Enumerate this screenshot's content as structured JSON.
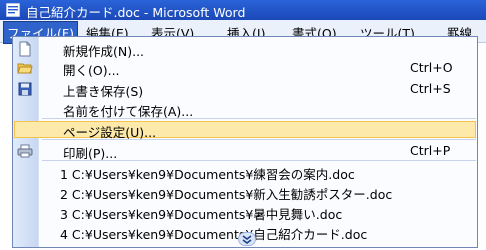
{
  "window": {
    "title": "自己紹介カード.doc - Microsoft Word"
  },
  "menubar": {
    "items": [
      {
        "label": "ファイル(F)"
      },
      {
        "label": "編集(E)"
      },
      {
        "label": "表示(V)"
      },
      {
        "label": "挿入(I)"
      },
      {
        "label": "書式(O)"
      },
      {
        "label": "ツール(T)"
      },
      {
        "label": "罫線"
      }
    ]
  },
  "file_menu": {
    "items": [
      {
        "label": "新規作成(N)...",
        "shortcut": "",
        "icon": "new-document-icon"
      },
      {
        "label": "開く(O)...",
        "shortcut": "Ctrl+O",
        "icon": "open-folder-icon"
      },
      {
        "label": "上書き保存(S)",
        "shortcut": "Ctrl+S",
        "icon": "save-disk-icon"
      },
      {
        "label": "名前を付けて保存(A)...",
        "shortcut": ""
      },
      {
        "label": "ページ設定(U)...",
        "shortcut": "",
        "highlighted": true
      },
      {
        "label": "印刷(P)...",
        "shortcut": "Ctrl+P",
        "icon": "printer-icon"
      }
    ],
    "recent_files": [
      "1 C:¥Users¥ken9¥Documents¥練習会の案内.doc",
      "2 C:¥Users¥ken9¥Documents¥新入生勧誘ポスター.doc",
      "3 C:¥Users¥ken9¥Documents¥暑中見舞い.doc",
      "4 C:¥Users¥ken9¥Documents¥自己紹介カード.doc"
    ],
    "expand_icon": "double-chevron-down-icon"
  },
  "colors": {
    "titlebar": "#1f56c9",
    "highlight": "#fde9a9",
    "highlight_border": "#f2c44f",
    "menu_active": "#2f63c9"
  }
}
